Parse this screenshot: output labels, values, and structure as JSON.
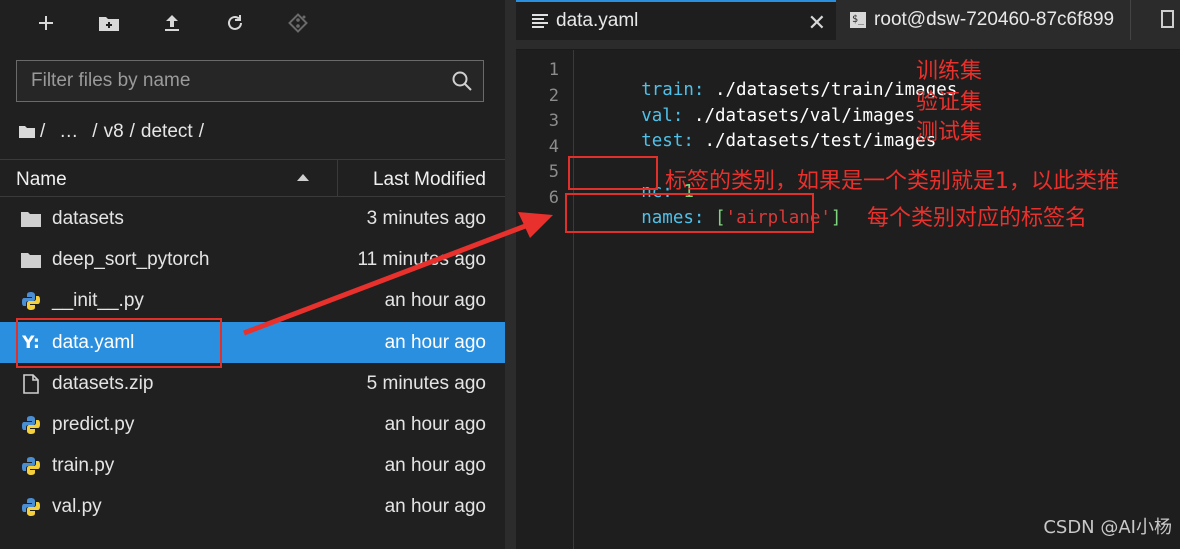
{
  "file_browser": {
    "filter_placeholder": "Filter files by name",
    "breadcrumb": {
      "root_sep": "/",
      "ellipsis": "…",
      "sep1": "/",
      "folder": "v8",
      "sep2": "/",
      "folder2": "detect",
      "sep3": "/"
    },
    "header": {
      "name": "Name",
      "last_modified": "Last Modified"
    },
    "files": [
      {
        "name": "datasets",
        "modified": "3 minutes ago",
        "icon": "folder-icon"
      },
      {
        "name": "deep_sort_pytorch",
        "modified": "11 minutes ago",
        "icon": "folder-icon"
      },
      {
        "name": "__init__.py",
        "modified": "an hour ago",
        "icon": "python-icon"
      },
      {
        "name": "data.yaml",
        "modified": "an hour ago",
        "icon": "yaml-icon",
        "yaml_glyph": "Y:",
        "selected": true
      },
      {
        "name": "datasets.zip",
        "modified": "5 minutes ago",
        "icon": "file-icon"
      },
      {
        "name": "predict.py",
        "modified": "an hour ago",
        "icon": "python-icon"
      },
      {
        "name": "train.py",
        "modified": "an hour ago",
        "icon": "python-icon"
      },
      {
        "name": "val.py",
        "modified": "an hour ago",
        "icon": "python-icon"
      }
    ]
  },
  "editor": {
    "tabs": [
      {
        "label": "data.yaml",
        "close": "✕"
      },
      {
        "label": "root@dsw-720460-87c6f899",
        "terminal_glyph": "$_"
      }
    ],
    "line_numbers": [
      "1",
      "2",
      "3",
      "4",
      "5",
      "6"
    ],
    "lines": [
      {
        "key": "train",
        "colon": ":",
        "value": " ./datasets/train/images"
      },
      {
        "key": "val",
        "colon": ":",
        "value": " ./datasets/val/images"
      },
      {
        "key": "test",
        "colon": ":",
        "value": " ./datasets/test/images"
      },
      {},
      {
        "key": "nc",
        "colon": ":",
        "number": " 1"
      },
      {
        "key": "names",
        "colon": ":",
        "bracket_open": " [",
        "string": "'airplane'",
        "bracket_close": "]"
      }
    ]
  },
  "annotations": {
    "train": "训练集",
    "val": "验证集",
    "test": "测试集",
    "nc_note": "标签的类别，如果是一个类别就是1，以此类推",
    "names_note": "每个类别对应的标签名"
  },
  "watermark": "CSDN @AI小杨",
  "colors": {
    "accent": "#2b8fe0",
    "annotation": "#e8302c",
    "yaml_key": "#4fc1e9",
    "yaml_number": "#7fd57f",
    "yaml_string": "#d83a3a"
  }
}
